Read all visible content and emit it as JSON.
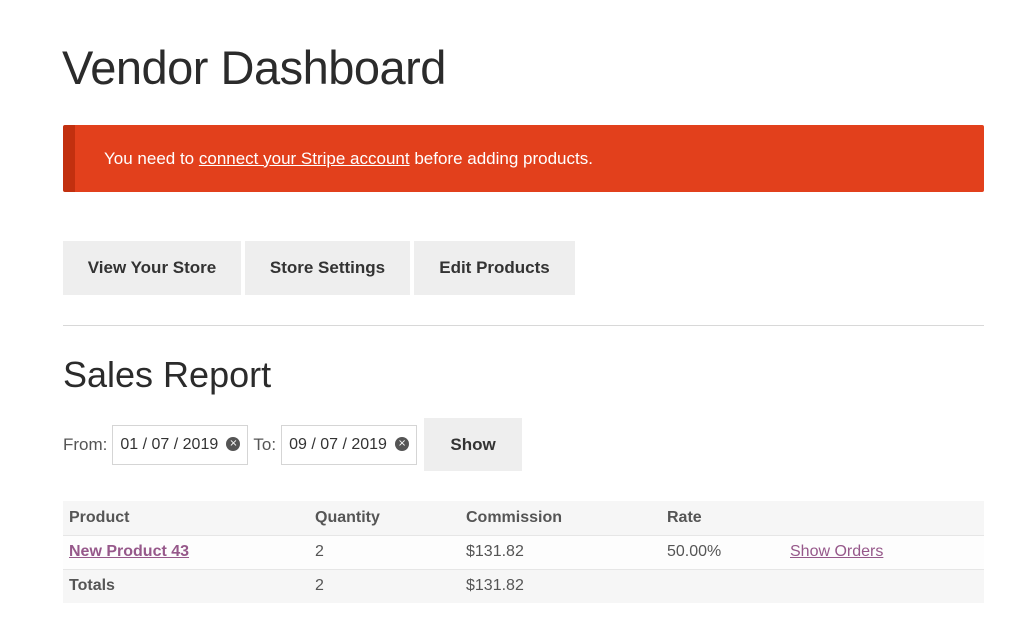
{
  "page": {
    "title": "Vendor Dashboard"
  },
  "notice": {
    "text_before": "You need to ",
    "link_text": "connect your Stripe account",
    "text_after": " before adding products.",
    "background": "#e2401c"
  },
  "buttons": {
    "view_store": "View Your Store",
    "store_settings": "Store Settings",
    "edit_products": "Edit Products"
  },
  "sales_report": {
    "title": "Sales Report",
    "from_label": "From:",
    "from_value": "01 / 07 / 2019",
    "to_label": "To:",
    "to_value": "09 / 07 / 2019",
    "show_label": "Show",
    "clear_icon": "×",
    "table": {
      "headers": [
        "Product",
        "Quantity",
        "Commission",
        "Rate",
        ""
      ],
      "rows": [
        {
          "product": "New Product 43",
          "quantity": "2",
          "commission": "$131.82",
          "rate": "50.00%",
          "action": "Show Orders"
        }
      ],
      "totals": {
        "label": "Totals",
        "quantity": "2",
        "commission": "$131.82"
      }
    }
  },
  "colors": {
    "link": "#96588a",
    "button_bg": "#eeeeee"
  }
}
